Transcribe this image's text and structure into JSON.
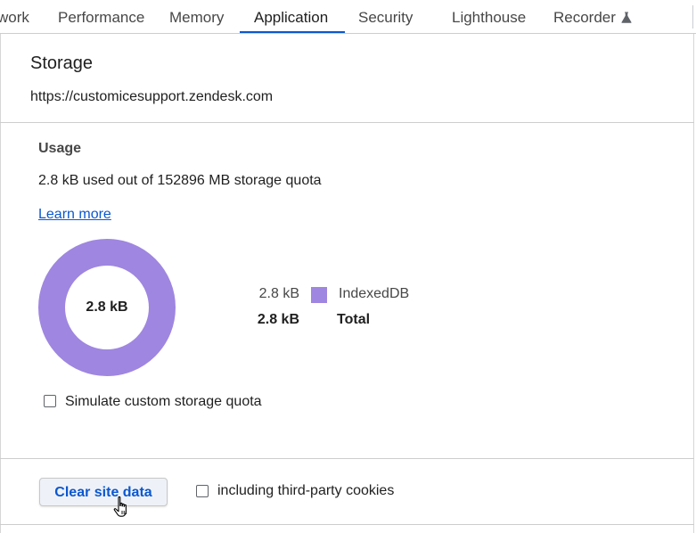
{
  "tabs": [
    {
      "label": "work"
    },
    {
      "label": "Performance"
    },
    {
      "label": "Memory"
    },
    {
      "label": "Application"
    },
    {
      "label": "Security"
    },
    {
      "label": "Lighthouse"
    },
    {
      "label": "Recorder"
    }
  ],
  "active_tab": "Application",
  "recorder_icon": "flask-icon",
  "storage": {
    "title": "Storage",
    "origin": "https://customicesupport.zendesk.com"
  },
  "usage": {
    "heading": "Usage",
    "summary": "2.8 kB used out of 152896 MB storage quota",
    "learn_more": "Learn more",
    "pie_center": "2.8 kB",
    "legend": [
      {
        "value": "2.8 kB",
        "label": "IndexedDB",
        "color": "#9f86e0"
      }
    ],
    "total": {
      "value": "2.8 kB",
      "label": "Total"
    }
  },
  "chart_data": {
    "type": "pie",
    "categories": [
      "IndexedDB"
    ],
    "values": [
      2.8
    ],
    "unit": "kB",
    "center_label": "2.8 kB"
  },
  "simulate_quota": {
    "label": "Simulate custom storage quota",
    "checked": false
  },
  "clear": {
    "button_label": "Clear site data",
    "third_party_label": "including third-party cookies",
    "third_party_checked": false
  },
  "colors": {
    "accent": "#0b57d0",
    "indexeddb": "#9f86e0"
  }
}
